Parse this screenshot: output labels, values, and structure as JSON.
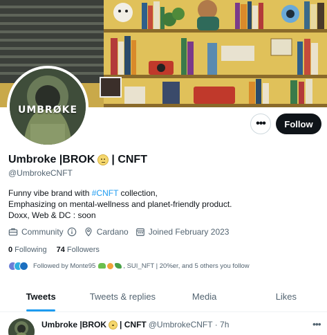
{
  "profile": {
    "avatar_text": "UMBRØKE",
    "name_part1": "Umbroke |BROK",
    "name_part2": "| CNFT",
    "handle": "@UmbrokeCNFT",
    "bio_line1_prefix": "Funny vibe brand with ",
    "bio_hashtag": "#CNFT",
    "bio_line1_suffix": " collection,",
    "bio_line2": "Emphasizing on mental-wellness and planet-friendly product.",
    "bio_line3": "Doxx, Web & DC : soon",
    "category": "Community",
    "location": "Cardano",
    "joined": "Joined February 2023",
    "following_count": "0",
    "following_label": "Following",
    "followers_count": "74",
    "followers_label": "Followers",
    "followed_by_prefix": "Followed by Monte95",
    "followed_by_suffix": ", SUI_NFT | 20%er, and 5 others you follow"
  },
  "actions": {
    "more_label": "•••",
    "follow_label": "Follow"
  },
  "tabs": [
    {
      "label": "Tweets",
      "active": true
    },
    {
      "label": "Tweets & replies",
      "active": false
    },
    {
      "label": "Media",
      "active": false
    },
    {
      "label": "Likes",
      "active": false
    }
  ],
  "tweet": {
    "name_part1": "Umbroke |BROK",
    "name_part2": "| CNFT",
    "handle_time": "@UmbrokeCNFT · 7h",
    "more_label": "•••"
  },
  "colors": {
    "accent": "#1d9bf0",
    "text": "#0f1419",
    "muted": "#536471",
    "follow_bg": "#0f1419"
  }
}
